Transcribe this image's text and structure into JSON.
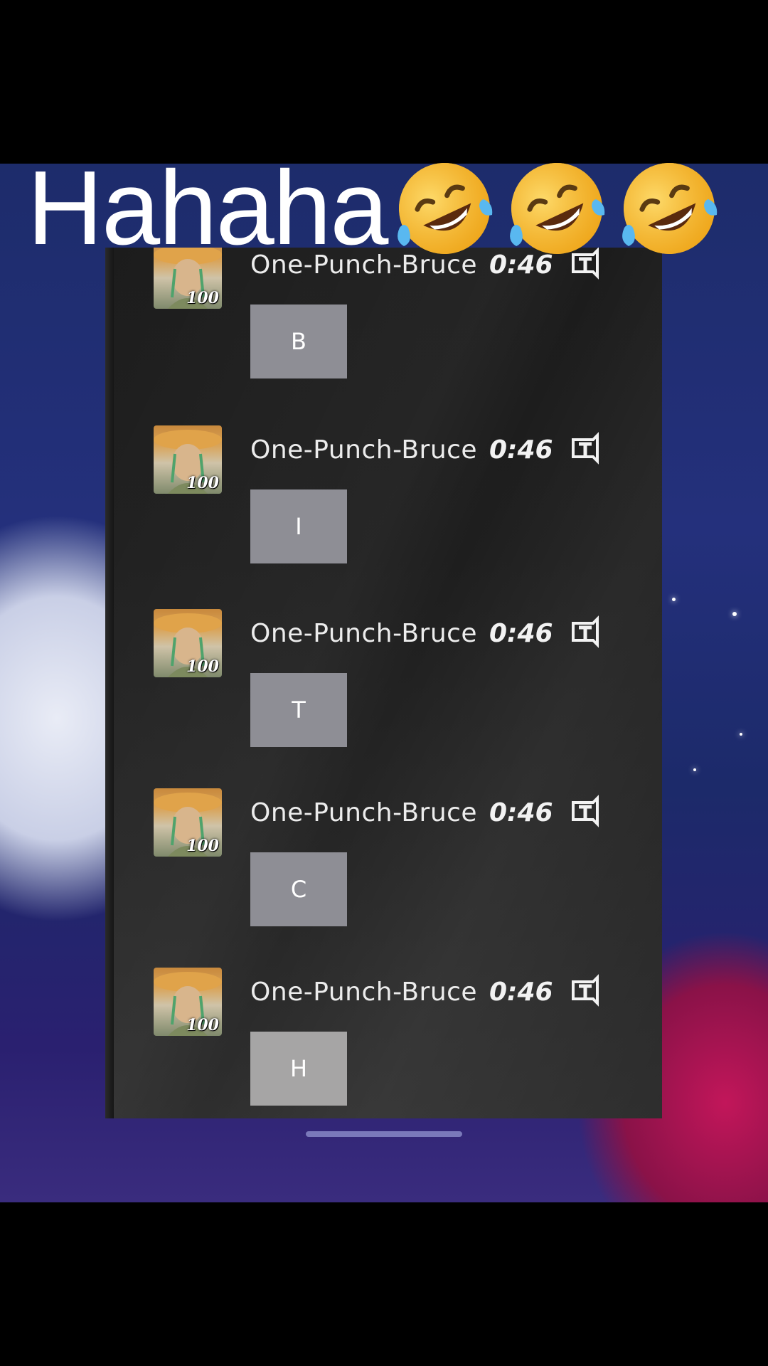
{
  "caption": {
    "text": "Hahaha",
    "emojis": [
      "rolling-on-floor-laughing-emoji",
      "rolling-on-floor-laughing-emoji",
      "rolling-on-floor-laughing-emoji"
    ]
  },
  "chat": {
    "entries": [
      {
        "player": "One-Punch-Bruce",
        "level": "100",
        "time": "0:46",
        "message": "B",
        "translate_icon": "translate-icon"
      },
      {
        "player": "One-Punch-Bruce",
        "level": "100",
        "time": "0:46",
        "message": "I",
        "translate_icon": "translate-icon"
      },
      {
        "player": "One-Punch-Bruce",
        "level": "100",
        "time": "0:46",
        "message": "T",
        "translate_icon": "translate-icon"
      },
      {
        "player": "One-Punch-Bruce",
        "level": "100",
        "time": "0:46",
        "message": "C",
        "translate_icon": "translate-icon"
      },
      {
        "player": "One-Punch-Bruce",
        "level": "100",
        "time": "0:46",
        "message": "H",
        "translate_icon": "translate-icon"
      }
    ]
  },
  "colors": {
    "panel": "#1e1e1e",
    "message_box": "#8e8e95",
    "text": "#ececec"
  }
}
